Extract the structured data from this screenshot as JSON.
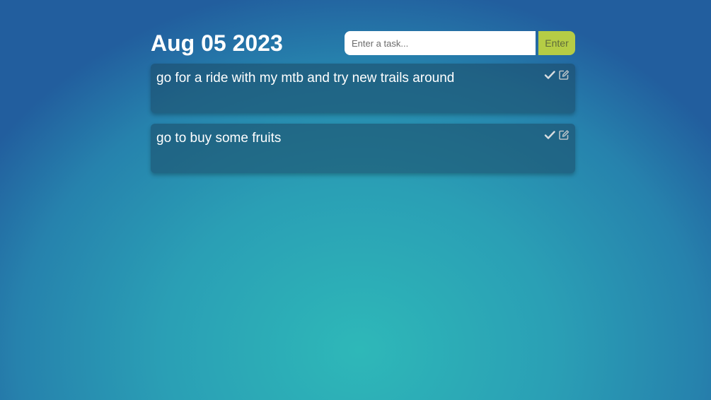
{
  "header": {
    "date": "Aug 05 2023"
  },
  "input": {
    "placeholder": "Enter a task...",
    "value": ""
  },
  "enter_button": {
    "label": "Enter"
  },
  "tasks": [
    {
      "text": "go for a ride with my mtb and try new trails around",
      "icons": [
        "check-icon",
        "edit-icon"
      ]
    },
    {
      "text": "go to buy some fruits",
      "icons": [
        "check-icon",
        "edit-icon"
      ]
    }
  ],
  "colors": {
    "accent_button": "#b5cc45",
    "card_background": "#1f5470",
    "text": "#ffffff",
    "icon": "#d8dde0"
  }
}
